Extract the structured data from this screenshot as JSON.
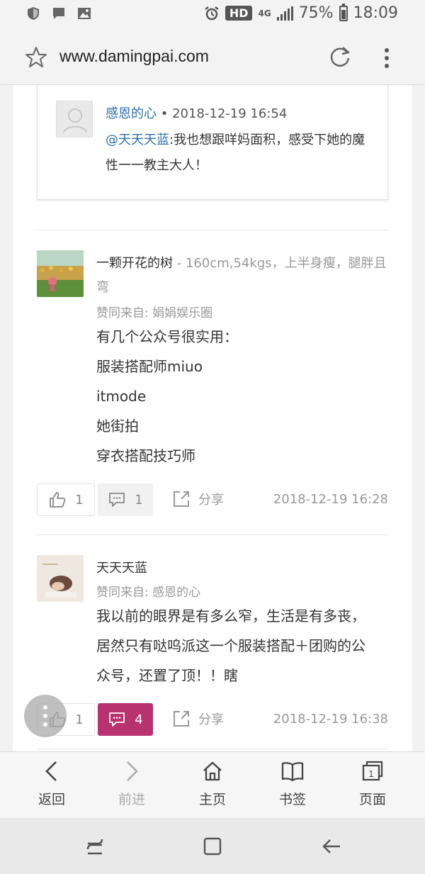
{
  "status_bar": {
    "hd_label": "HD",
    "network": "4G",
    "battery": "75%",
    "time": "18:09"
  },
  "address_bar": {
    "url": "www.damingpai.com"
  },
  "reply": {
    "author": "感恩的心",
    "separator": "•",
    "time": "2018-12-19 16:54",
    "mention": "@天天天蓝",
    "text": ":我也想跟咩妈面积，感受下她的魔性一一教主大人！"
  },
  "posts": [
    {
      "author": "一颗开花的树",
      "description": " - 160cm,54kgs，上半身瘦，腿胖且弯",
      "source": "赞同来自: 娟娟娱乐圈",
      "body": [
        "有几个公众号很实用：",
        "服装搭配师miuo",
        "itmode",
        "她街拍",
        "穿衣搭配技巧师"
      ],
      "likes": "1",
      "comments": "1",
      "share_label": "分享",
      "time": "2018-12-19 16:28"
    },
    {
      "author": "天天天蓝",
      "description": "",
      "source": "赞同来自: 感恩的心",
      "body": [
        "我以前的眼界是有多么窄，生活是有多丧，居然只有哒呜派这一个服装搭配＋团购的公众号，还置了顶！！瞎"
      ],
      "likes": "1",
      "comments": "4",
      "share_label": "分享",
      "time": "2018-12-19 16:38"
    }
  ],
  "bottom_nav": {
    "back": "返回",
    "forward": "前进",
    "home": "主页",
    "bookmarks": "书签",
    "pages": "页面",
    "pages_count": "1"
  },
  "colors": {
    "link": "#2a6fb0",
    "accent": "#b8326f"
  }
}
